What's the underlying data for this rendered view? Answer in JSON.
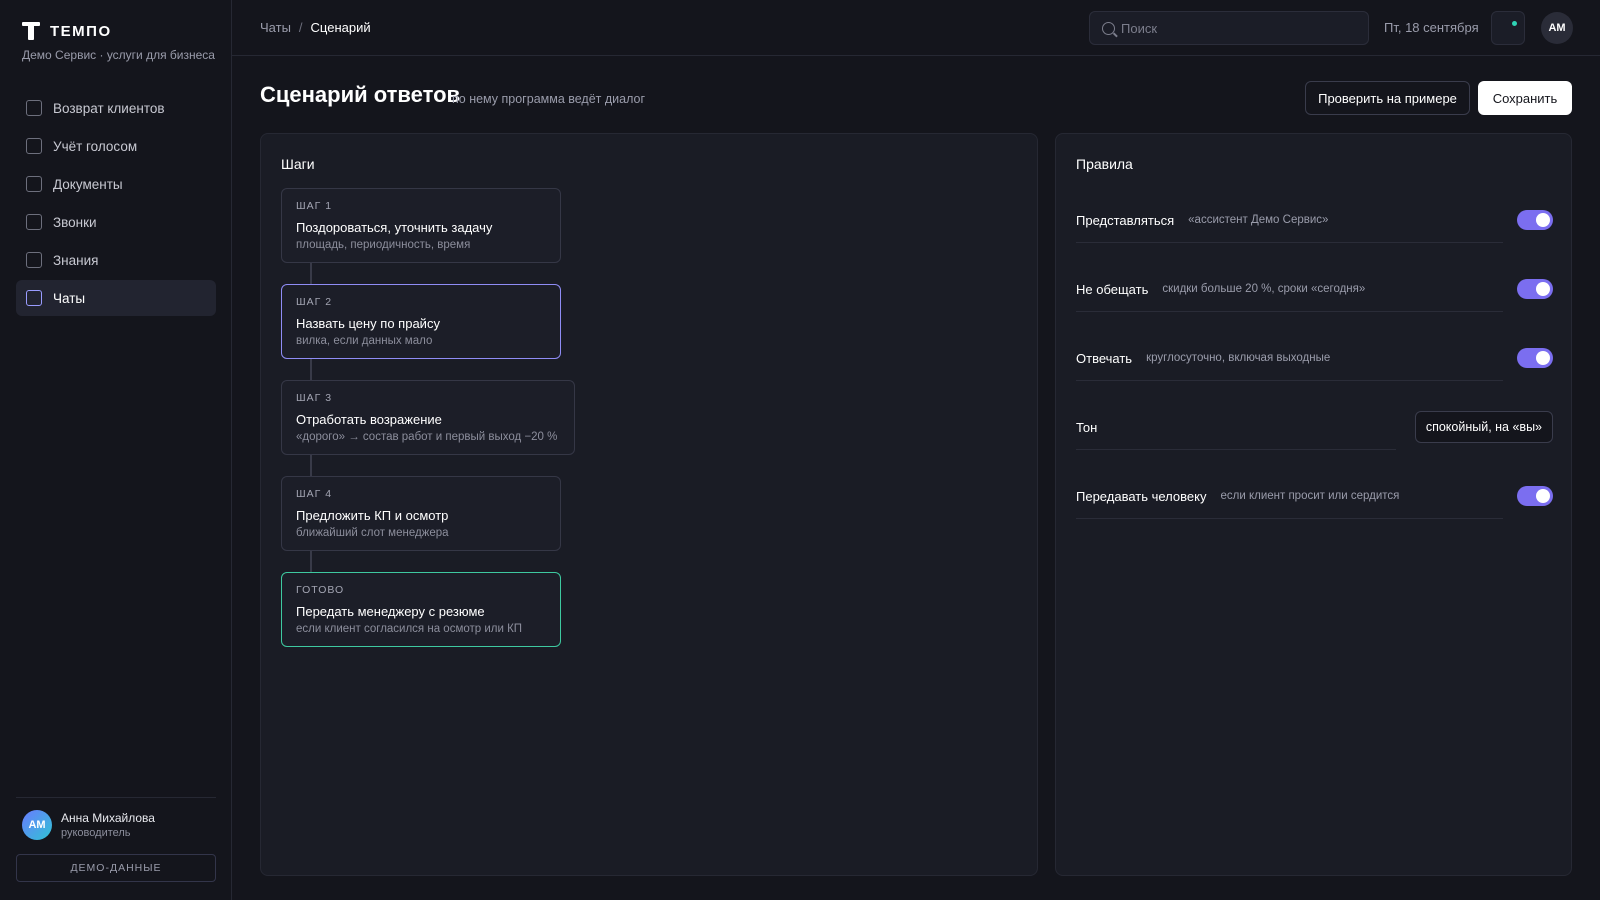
{
  "brand": {
    "name": "ТЕМПО",
    "subtitle": "Демо Сервис · услуги для бизнеса"
  },
  "sidebar": {
    "items": [
      {
        "label": "Возврат клиентов"
      },
      {
        "label": "Учёт голосом"
      },
      {
        "label": "Документы"
      },
      {
        "label": "Звонки"
      },
      {
        "label": "Знания"
      },
      {
        "label": "Чаты"
      }
    ],
    "active_index": 5,
    "user": {
      "initials": "АМ",
      "name": "Анна Михайлова",
      "role": "руководитель"
    },
    "demo_label": "ДЕМО-ДАННЫЕ"
  },
  "header": {
    "breadcrumb": [
      "Чаты",
      "Сценарий"
    ],
    "breadcrumb_sep": "/",
    "search_placeholder": "Поиск",
    "date": "Пт, 18 сентября",
    "avatar_initials": "АМ"
  },
  "page": {
    "title": "Сценарий ответов",
    "subtitle": "по нему программа ведёт диалог",
    "test_button": "Проверить на примере",
    "save_button": "Сохранить"
  },
  "steps_panel": {
    "title": "Шаги",
    "steps": [
      {
        "label": "ШАГ 1",
        "title": "Поздороваться, уточнить задачу",
        "desc": "площадь, периодичность, время",
        "state": "default"
      },
      {
        "label": "ШАГ 2",
        "title": "Назвать цену по прайсу",
        "desc": "вилка, если данных мало",
        "state": "active"
      },
      {
        "label": "ШАГ 3",
        "title": "Отработать возражение",
        "desc": "«дорого» → состав работ и первый выход −20 %",
        "state": "default"
      },
      {
        "label": "ШАГ 4",
        "title": "Предложить КП и осмотр",
        "desc": "ближайший слот менеджера",
        "state": "default"
      },
      {
        "label": "ГОТОВО",
        "title": "Передать менеджеру с резюме",
        "desc": "если клиент согласился на осмотр или КП",
        "state": "done"
      }
    ]
  },
  "rules_panel": {
    "title": "Правила",
    "rules": [
      {
        "name": "Представляться",
        "desc": "«ассистент Демо Сервис»",
        "enabled": true
      },
      {
        "name": "Не обещать",
        "desc": "скидки больше 20 %, сроки «сегодня»",
        "enabled": true
      },
      {
        "name": "Отвечать",
        "desc": "круглосуточно, включая выходные",
        "enabled": true
      },
      {
        "name": "Тон",
        "desc": "",
        "select_value": "спокойный, на «вы»"
      },
      {
        "name": "Передавать человеку",
        "desc": "если клиент просит или сердится",
        "enabled": true
      }
    ]
  },
  "colors": {
    "background": "#14151c",
    "panel": "#1a1c25",
    "accent": "#7b6ef0",
    "active_border": "#8f8cf5",
    "done_border": "#3ec9a0",
    "notification_dot": "#2fd3b5"
  },
  "icons": {
    "logo": "logo-t-icon",
    "search": "search-icon",
    "notifications": "bell-icon",
    "nav_item": "checkbox-square-icon"
  }
}
